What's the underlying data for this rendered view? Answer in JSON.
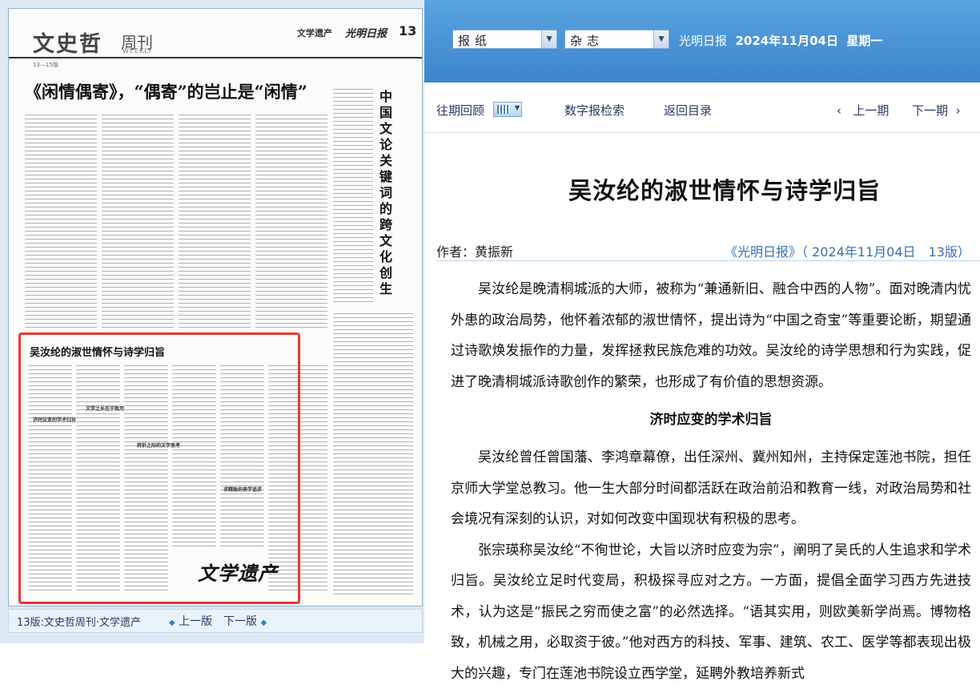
{
  "left": {
    "newspaper_page": {
      "masthead": "文史哲",
      "masthead_sub": "周刊",
      "masthead_en": "WEEKLY",
      "section": "文学遗产",
      "paper_name": "光明日报",
      "page_number": "13",
      "pages_tag": "13—15版",
      "headline": "《闲情偶寄》，“偶寄”的岂止是“闲情”",
      "vertical_title": [
        "中",
        "国",
        "文",
        "论",
        "关",
        "键",
        "词",
        "的",
        "跨",
        "文",
        "化",
        "创",
        "生"
      ],
      "highlighted_title": "吴汝纶的淑世情怀与诗学归旨",
      "sub_heads": [
        "济时应变的学术归旨",
        "文学之长在于致用",
        "求精致的美学追求",
        "转折之际的文学思考"
      ],
      "seal_text": "文学遗产"
    },
    "bottom_bar": {
      "page_label": "13版:文史哲周刊·文学遗产",
      "prev": "上一版",
      "next": "下一版"
    }
  },
  "top": {
    "select_paper": "报纸",
    "select_magazine": "杂志",
    "brand": "光明日报",
    "date": "2024年11月04日",
    "weekday": "星期一"
  },
  "nav": {
    "past_issues": "往期回顾",
    "digital_search": "数字报检索",
    "back_to_list": "返回目录",
    "prev_issue": "上一期",
    "next_issue": "下一期"
  },
  "article": {
    "title": "吴汝纶的淑世情怀与诗学归旨",
    "author_line": "作者：黄振新",
    "source_line": "《光明日报》（ 2024年11月04日　13版）",
    "paragraphs": [
      "吴汝纶是晚清桐城派的大师，被称为“兼通新旧、融合中西的人物”。面对晚清内忧外患的政治局势，他怀着浓郁的淑世情怀，提出诗为“中国之奇宝”等重要论断，期望通过诗歌焕发振作的力量，发挥拯救民族危难的功效。吴汝纶的诗学思想和行为实践，促进了晚清桐城派诗歌创作的繁荣，也形成了有价值的思想资源。"
    ],
    "section_heading": "济时应变的学术归旨",
    "paragraphs2": [
      "吴汝纶曾任曾国藩、李鸿章幕僚，出任深州、冀州知州，主持保定莲池书院，担任京师大学堂总教习。他一生大部分时间都活跃在政治前沿和教育一线，对政治局势和社会境况有深刻的认识，对如何改变中国现状有积极的思考。",
      "张宗瑛称吴汝纶“不徇世论，大旨以济时应变为宗”，阐明了吴氏的人生追求和学术归旨。吴汝纶立足时代变局，积极探寻应对之方。一方面，提倡全面学习西方先进技术，认为这是“振民之穷而使之富”的必然选择。“语其实用，则欧美新学尚焉。博物格致，机械之用，必取资于彼。”他对西方的科技、军事、建筑、农工、医学等都表现出极大的兴趣，专门在莲池书院设立西学堂，延聘外教培养新式"
    ]
  },
  "colors": {
    "accent_blue": "#3d85cb",
    "highlight_red": "#e53935",
    "link_blue": "#3a6fb0"
  }
}
